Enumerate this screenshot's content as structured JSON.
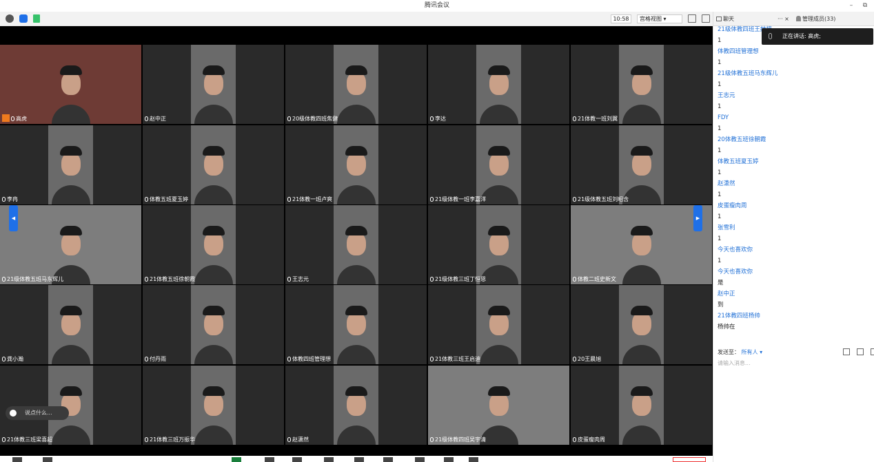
{
  "window": {
    "title": "腾讯会议",
    "minimize": "–",
    "restore": "⧉"
  },
  "toolbar": {
    "time": "10:58",
    "view_mode": "宫格视图 ▾"
  },
  "side_tabs": {
    "chat": "聊天",
    "members": "管理成员(33)",
    "more": "··· ×"
  },
  "speaking": {
    "label": "正在讲话: 高虎;"
  },
  "participants": [
    {
      "name": "高虎"
    },
    {
      "name": "赵中正"
    },
    {
      "name": "20级体教四班焦健"
    },
    {
      "name": "李达"
    },
    {
      "name": "21体教一班刘翼"
    },
    {
      "name": "李冉"
    },
    {
      "name": "体教五班夏玉婷"
    },
    {
      "name": "21体教一班卢爽"
    },
    {
      "name": "21级体教一班李嘉洋"
    },
    {
      "name": "21级体教五班刘昭含"
    },
    {
      "name": "21级体教五班马东辉儿"
    },
    {
      "name": "21体教五班徐朝霞"
    },
    {
      "name": "王志元"
    },
    {
      "name": "21级体教三班丁恒恩"
    },
    {
      "name": "体教二班史新文"
    },
    {
      "name": "龚小瀚"
    },
    {
      "name": "付丹雨"
    },
    {
      "name": "体教四班管理想"
    },
    {
      "name": "21体教三班王启迪"
    },
    {
      "name": "20王晨旭"
    },
    {
      "name": "21体教三班梁喜超"
    },
    {
      "name": "21体教三班万振华"
    },
    {
      "name": "赵潇然"
    },
    {
      "name": "21级体教四班吴宇清"
    },
    {
      "name": "皮蛋瘦肉周"
    }
  ],
  "chat_input": {
    "placeholder": "说点什么..."
  },
  "chat_messages": [
    {
      "sender": "21级体教四班王赫楠",
      "text": "1"
    },
    {
      "sender": "体教四班管理想",
      "text": "1"
    },
    {
      "sender": "21级体教五班马东辉儿",
      "text": "1"
    },
    {
      "sender": "王志元",
      "text": "1"
    },
    {
      "sender": "FDY",
      "text": "1"
    },
    {
      "sender": "20体教五班徐朝霞",
      "text": "1"
    },
    {
      "sender": "体教五班夏玉婷",
      "text": "1"
    },
    {
      "sender": "赵潇然",
      "text": "1"
    },
    {
      "sender": "皮蛋瘦肉周",
      "text": "1"
    },
    {
      "sender": "张雪利",
      "text": "1"
    },
    {
      "sender": "今天也喜欢你",
      "text": "1"
    },
    {
      "sender": "今天也喜欢你",
      "text": "是"
    },
    {
      "sender": "赵中正",
      "text": "到"
    },
    {
      "sender": "21体教四班杨帅",
      "text": "杨帅在"
    }
  ],
  "send_to": {
    "label": "发送至：",
    "value": "所有人 ▾"
  },
  "message_placeholder": "请输入消息..."
}
